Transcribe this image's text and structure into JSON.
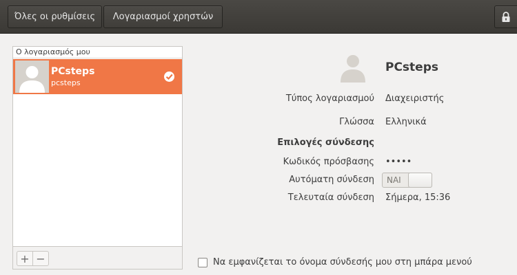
{
  "header": {
    "all_settings_label": "Όλες οι ρυθμίσεις",
    "users_label": "Λογαριασμοί χρηστών",
    "lock_icon": "lock-icon"
  },
  "sidebar": {
    "section_title": "Ο λογαριασμός μου",
    "users": [
      {
        "name": "PCsteps",
        "login": "pcsteps",
        "selected": true,
        "icon": "checkmark-icon"
      }
    ],
    "add_label": "+",
    "remove_label": "−"
  },
  "details": {
    "name": "PCsteps",
    "account_type_label": "Τύπος λογαριασμού",
    "account_type_value": "Διαχειριστής",
    "language_label": "Γλώσσα",
    "language_value": "Ελληνικά",
    "login_options_label": "Επιλογές σύνδεσης",
    "password_label": "Κωδικός πρόσβασης",
    "password_value": "•••••",
    "auto_login_label": "Αυτόματη σύνδεση",
    "auto_login_switch_text": "ΝΑΙ",
    "last_login_label": "Τελευταία σύνδεση",
    "last_login_value": "Σήμερα, 15:36"
  },
  "footer": {
    "show_login_name_label": "Να εμφανίζεται το όνομα σύνδεσής μου στη μπάρα μενού",
    "show_login_name_checked": false
  },
  "colors": {
    "accent": "#f07746",
    "headerbar": "#3f3d39"
  }
}
